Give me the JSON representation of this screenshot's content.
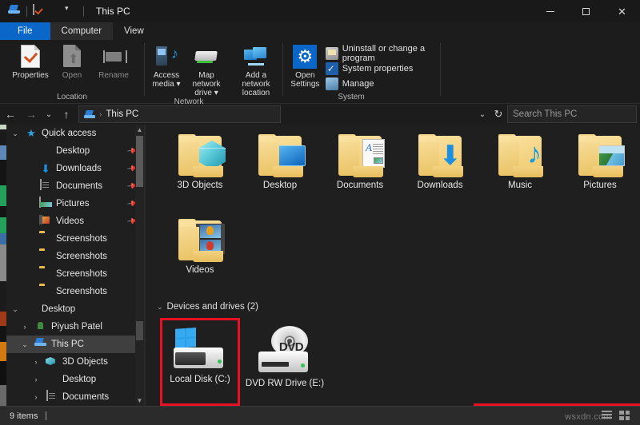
{
  "window": {
    "title": "This PC",
    "quick_access_icons": [
      "this-pc-icon",
      "properties-icon",
      "delete-icon",
      "customize-chevron-icon"
    ],
    "controls": {
      "minimize": "–",
      "maximize": "□",
      "close": "✕"
    }
  },
  "tabs": [
    {
      "id": "file",
      "label": "File"
    },
    {
      "id": "computer",
      "label": "Computer"
    },
    {
      "id": "view",
      "label": "View"
    }
  ],
  "ribbon": {
    "groups": [
      {
        "title": "Location",
        "buttons": [
          {
            "label": "Properties",
            "icon": "properties-icon",
            "enabled": true
          },
          {
            "label": "Open",
            "icon": "open-icon",
            "enabled": false
          },
          {
            "label": "Rename",
            "icon": "rename-icon",
            "enabled": false
          }
        ]
      },
      {
        "title": "Network",
        "buttons": [
          {
            "label": "Access media",
            "icon": "access-media-icon",
            "dropdown": true
          },
          {
            "label": "Map network drive",
            "icon": "map-network-drive-icon",
            "dropdown": true
          },
          {
            "label": "Add a network location",
            "icon": "add-network-location-icon",
            "dropdown": false
          }
        ]
      },
      {
        "title": "System",
        "big_button": {
          "label": "Open Settings",
          "icon": "gear-icon"
        },
        "small_items": [
          {
            "label": "Uninstall or change a program",
            "icon": "uninstall-icon"
          },
          {
            "label": "System properties",
            "icon": "system-properties-icon"
          },
          {
            "label": "Manage",
            "icon": "manage-icon"
          }
        ]
      }
    ]
  },
  "addressbar": {
    "back": "←",
    "forward": "→",
    "recent": "⌄",
    "up": "↑",
    "path_icon": "this-pc-icon",
    "separator": "›",
    "path": "This PC",
    "history_chevron": "⌄",
    "refresh": "↻"
  },
  "search": {
    "placeholder": "Search This PC"
  },
  "sidebar": {
    "items": [
      {
        "label": "Quick access",
        "icon": "star-icon",
        "chevron": "⌄",
        "indent": 0,
        "pinned": false,
        "selected": false
      },
      {
        "label": "Desktop",
        "icon": "desktop-icon",
        "chevron": "",
        "indent": 1,
        "pinned": true,
        "selected": false
      },
      {
        "label": "Downloads",
        "icon": "downloads-icon",
        "chevron": "",
        "indent": 1,
        "pinned": true,
        "selected": false
      },
      {
        "label": "Documents",
        "icon": "documents-icon",
        "chevron": "",
        "indent": 1,
        "pinned": true,
        "selected": false
      },
      {
        "label": "Pictures",
        "icon": "pictures-icon",
        "chevron": "",
        "indent": 1,
        "pinned": true,
        "selected": false
      },
      {
        "label": "Videos",
        "icon": "videos-icon",
        "chevron": "",
        "indent": 1,
        "pinned": true,
        "selected": false
      },
      {
        "label": "Screenshots",
        "icon": "folder-icon",
        "chevron": "",
        "indent": 1,
        "pinned": false,
        "selected": false
      },
      {
        "label": "Screenshots",
        "icon": "folder-icon",
        "chevron": "",
        "indent": 1,
        "pinned": false,
        "selected": false
      },
      {
        "label": "Screenshots",
        "icon": "folder-icon",
        "chevron": "",
        "indent": 1,
        "pinned": false,
        "selected": false
      },
      {
        "label": "Screenshots",
        "icon": "folder-icon",
        "chevron": "",
        "indent": 1,
        "pinned": false,
        "selected": false
      },
      {
        "label": "Desktop",
        "icon": "desktop-icon",
        "chevron": "⌄",
        "indent": 0,
        "pinned": false,
        "selected": false
      },
      {
        "label": "Piyush Patel",
        "icon": "user-folder-icon",
        "chevron": "›",
        "indent": 1,
        "pinned": false,
        "selected": false
      },
      {
        "label": "This PC",
        "icon": "this-pc-icon",
        "chevron": "⌄",
        "indent": 1,
        "pinned": false,
        "selected": true
      },
      {
        "label": "3D Objects",
        "icon": "3d-objects-icon",
        "chevron": "›",
        "indent": 2,
        "pinned": false,
        "selected": false
      },
      {
        "label": "Desktop",
        "icon": "desktop-icon",
        "chevron": "›",
        "indent": 2,
        "pinned": false,
        "selected": false
      },
      {
        "label": "Documents",
        "icon": "documents-icon",
        "chevron": "›",
        "indent": 2,
        "pinned": false,
        "selected": false
      }
    ]
  },
  "content": {
    "folders": [
      {
        "label": "3D Objects",
        "icon": "folder-3d-objects-icon"
      },
      {
        "label": "Desktop",
        "icon": "folder-desktop-icon"
      },
      {
        "label": "Documents",
        "icon": "folder-documents-icon"
      },
      {
        "label": "Downloads",
        "icon": "folder-downloads-icon"
      },
      {
        "label": "Music",
        "icon": "folder-music-icon"
      },
      {
        "label": "Pictures",
        "icon": "folder-pictures-icon"
      },
      {
        "label": "Videos",
        "icon": "folder-videos-icon"
      }
    ],
    "group_header": {
      "chevron": "⌄",
      "label": "Devices and drives (2)"
    },
    "drives": [
      {
        "label": "Local Disk (C:)",
        "icon": "hard-drive-icon",
        "highlighted": true
      },
      {
        "label": "DVD RW Drive (E:)",
        "icon": "dvd-drive-icon",
        "highlighted": false,
        "disc_text": "DVD"
      }
    ]
  },
  "statusbar": {
    "item_count": "9 items",
    "view_icons": [
      "details-view-icon",
      "large-icons-view-icon"
    ],
    "watermark": "wsxdn.com"
  },
  "colors": {
    "accent": "#0a67c8",
    "highlight_box": "#e81123",
    "window_bg": "#1f1f1f",
    "selection": "#3f3f3f"
  }
}
